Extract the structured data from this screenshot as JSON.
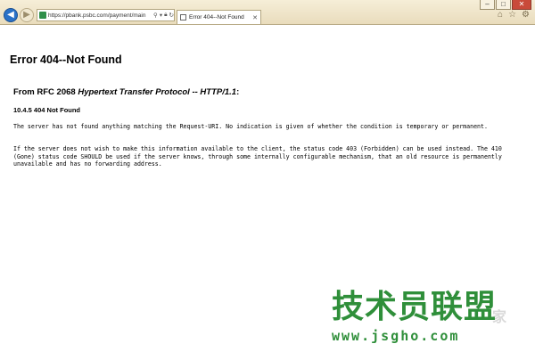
{
  "browser": {
    "url": "https://pbank.psbc.com/payment/main",
    "tab_title": "Error 404--Not Found",
    "window_controls": [
      "minimize-icon",
      "maximize-icon",
      "close-icon"
    ],
    "nav_icons": [
      "back-icon",
      "forward-icon"
    ],
    "address_controls": [
      "search-icon",
      "dropdown-icon",
      "lock-icon",
      "refresh-icon"
    ],
    "toolbar_icons": [
      "home-icon",
      "star-icon",
      "gear-icon"
    ]
  },
  "page": {
    "title": "Error 404--Not Found",
    "subtitle_prefix": "From RFC 2068 ",
    "subtitle_italic": "Hypertext Transfer Protocol -- HTTP/1.1",
    "subtitle_suffix": ":",
    "section": "10.4.5 404 Not Found",
    "paragraph1": "The server has not found anything matching the Request-URI. No indication is given of whether the condition is temporary or permanent.",
    "paragraph2": "If the server does not wish to make this information available to the client, the status code 403 (Forbidden) can be used instead. The 410 (Gone) status code SHOULD be used if the server knows, through some internally configurable mechanism, that an old resource is permanently unavailable and has no forwarding address."
  },
  "watermark": {
    "text": "技术员联盟",
    "url": "www.jsgho.com",
    "faint_text": "家"
  }
}
